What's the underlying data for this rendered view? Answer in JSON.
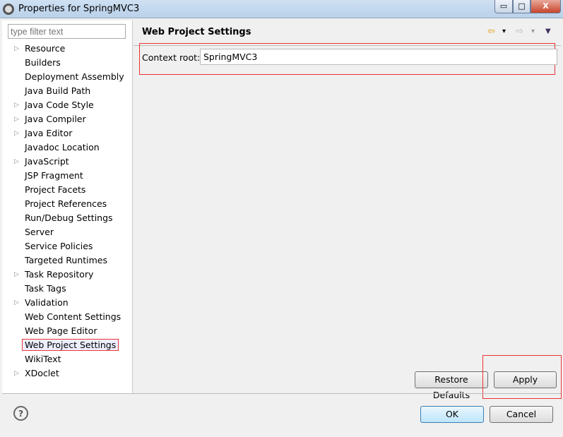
{
  "window": {
    "title": "Properties for SpringMVC3",
    "minimize": "▭",
    "maximize": "□",
    "close": "X"
  },
  "filter": {
    "placeholder": "type filter text"
  },
  "tree": [
    {
      "label": "Resource",
      "expandable": true
    },
    {
      "label": "Builders"
    },
    {
      "label": "Deployment Assembly"
    },
    {
      "label": "Java Build Path"
    },
    {
      "label": "Java Code Style",
      "expandable": true
    },
    {
      "label": "Java Compiler",
      "expandable": true
    },
    {
      "label": "Java Editor",
      "expandable": true
    },
    {
      "label": "Javadoc Location"
    },
    {
      "label": "JavaScript",
      "expandable": true
    },
    {
      "label": "JSP Fragment"
    },
    {
      "label": "Project Facets"
    },
    {
      "label": "Project References"
    },
    {
      "label": "Run/Debug Settings"
    },
    {
      "label": "Server"
    },
    {
      "label": "Service Policies"
    },
    {
      "label": "Targeted Runtimes"
    },
    {
      "label": "Task Repository",
      "expandable": true
    },
    {
      "label": "Task Tags"
    },
    {
      "label": "Validation",
      "expandable": true
    },
    {
      "label": "Web Content Settings"
    },
    {
      "label": "Web Page Editor"
    },
    {
      "label": "Web Project Settings",
      "selected": true
    },
    {
      "label": "WikiText"
    },
    {
      "label": "XDoclet",
      "expandable": true
    }
  ],
  "page": {
    "title": "Web Project Settings",
    "context_root_label": "Context root:",
    "context_root_value": "SpringMVC3",
    "back_icon": "⇦",
    "forward_icon": "⇨",
    "dropdown_icon": "▾",
    "menu_icon": "▼"
  },
  "buttons": {
    "restore": "Restore Defaults",
    "apply": "Apply",
    "ok": "OK",
    "cancel": "Cancel",
    "help": "?"
  },
  "colors": {
    "highlight": "#e33333",
    "back_arrow": "#e0a000"
  }
}
